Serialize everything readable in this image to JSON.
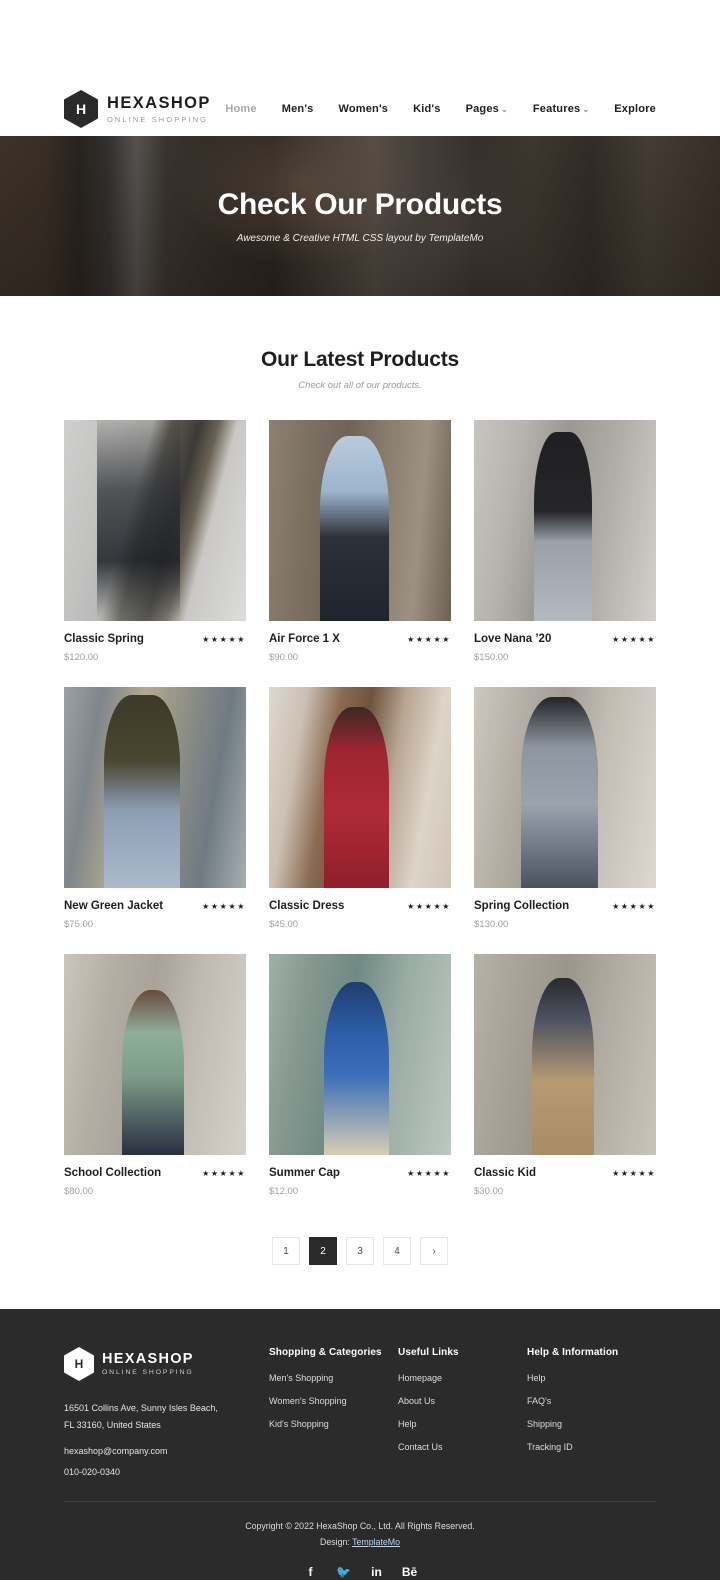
{
  "header": {
    "logo": {
      "letter": "H",
      "name": "HEXASHOP",
      "tagline": "ONLINE SHOPPING"
    },
    "nav": [
      {
        "label": "Home",
        "active": true,
        "caret": false
      },
      {
        "label": "Men's",
        "active": false,
        "caret": false
      },
      {
        "label": "Women's",
        "active": false,
        "caret": false
      },
      {
        "label": "Kid's",
        "active": false,
        "caret": false
      },
      {
        "label": "Pages",
        "active": false,
        "caret": true
      },
      {
        "label": "Features",
        "active": false,
        "caret": true
      },
      {
        "label": "Explore",
        "active": false,
        "caret": false
      }
    ]
  },
  "hero": {
    "title": "Check Our Products",
    "subtitle": "Awesome & Creative HTML CSS layout by TemplateMo"
  },
  "section": {
    "title": "Our Latest Products",
    "subtitle": "Check out all of our products."
  },
  "products": [
    {
      "name": "Classic Spring",
      "price": "$120.00",
      "stars": "★★★★★",
      "img": "ph-1"
    },
    {
      "name": "Air Force 1 X",
      "price": "$90.00",
      "stars": "★★★★★",
      "img": "ph-2"
    },
    {
      "name": "Love Nana ’20",
      "price": "$150.00",
      "stars": "★★★★★",
      "img": "ph-3"
    },
    {
      "name": "New Green Jacket",
      "price": "$75.00",
      "stars": "★★★★★",
      "img": "ph-4"
    },
    {
      "name": "Classic Dress",
      "price": "$45.00",
      "stars": "★★★★★",
      "img": "ph-5"
    },
    {
      "name": "Spring Collection",
      "price": "$130.00",
      "stars": "★★★★★",
      "img": "ph-6"
    },
    {
      "name": "School Collection",
      "price": "$80.00",
      "stars": "★★★★★",
      "img": "ph-7"
    },
    {
      "name": "Summer Cap",
      "price": "$12.00",
      "stars": "★★★★★",
      "img": "ph-8"
    },
    {
      "name": "Classic Kid",
      "price": "$30.00",
      "stars": "★★★★★",
      "img": "ph-9"
    }
  ],
  "pagination": {
    "pages": [
      {
        "label": "1",
        "active": false
      },
      {
        "label": "2",
        "active": true
      },
      {
        "label": "3",
        "active": false
      },
      {
        "label": "4",
        "active": false
      },
      {
        "label": "›",
        "active": false
      }
    ]
  },
  "footer": {
    "logo": {
      "letter": "H",
      "name": "HEXASHOP",
      "tagline": "ONLINE SHOPPING"
    },
    "address_line1": "16501 Collins Ave, Sunny Isles Beach,",
    "address_line2": "FL 33160, United States",
    "email": "hexashop@company.com",
    "phone": "010-020-0340",
    "columns": [
      {
        "title": "Shopping & Categories",
        "links": [
          "Men's Shopping",
          "Women's Shopping",
          "Kid's Shopping"
        ]
      },
      {
        "title": "Useful Links",
        "links": [
          "Homepage",
          "About Us",
          "Help",
          "Contact Us"
        ]
      },
      {
        "title": "Help & Information",
        "links": [
          "Help",
          "FAQ's",
          "Shipping",
          "Tracking ID"
        ]
      }
    ],
    "copyright": "Copyright © 2022 HexaShop Co., Ltd. All Rights Reserved.",
    "design_prefix": "Design: ",
    "design_link": "TemplateMo",
    "socials": [
      {
        "name": "facebook-icon",
        "glyph": "f"
      },
      {
        "name": "twitter-icon",
        "glyph": "🐦"
      },
      {
        "name": "linkedin-icon",
        "glyph": "in"
      },
      {
        "name": "behance-icon",
        "glyph": "Bē"
      }
    ]
  },
  "colors": {
    "accent_dark": "#2a2a2a",
    "footer_bg": "#2b2b2b",
    "muted": "#a0a0a0",
    "link_accent": "#bcd3e8"
  }
}
